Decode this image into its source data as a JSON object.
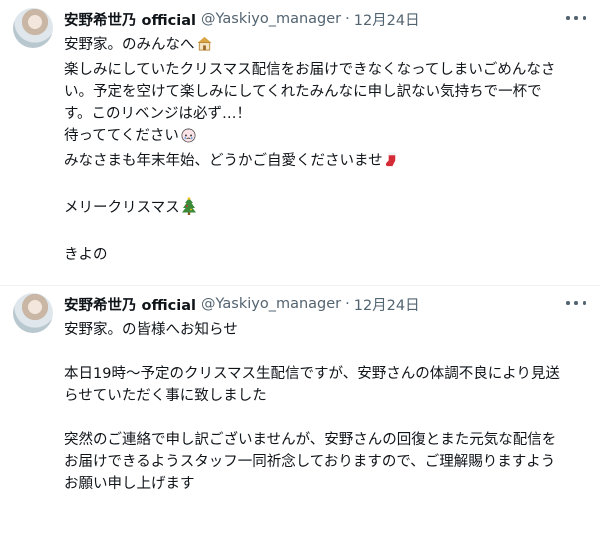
{
  "tweets": [
    {
      "author_name": "安野希世乃 official",
      "handle": "@Yaskiyo_manager",
      "separator": "·",
      "date": "12月24日",
      "body": [
        {
          "text": "安野家。のみんなへ",
          "emoji": "house-emoji"
        },
        {
          "text": "楽しみにしていたクリスマス配信をお届けできなくなってしまいごめんなさ"
        },
        {
          "text": "い。予定を空けて楽しみにしてくれたみんなに申し訳ない気持ちで一杯で"
        },
        {
          "text": "す。このリベンジは必ず…！"
        },
        {
          "text": "待っててください",
          "emoji": "crying-face-emoji"
        },
        {
          "text": "みなさまも年末年始、どうかご自愛くださいませ",
          "emoji": "stocking-emoji"
        },
        {
          "text": ""
        },
        {
          "text": "メリークリスマス",
          "emoji": "christmas-tree-emoji"
        },
        {
          "text": ""
        },
        {
          "text": "きよの"
        }
      ]
    },
    {
      "author_name": "安野希世乃 official",
      "handle": "@Yaskiyo_manager",
      "separator": "·",
      "date": "12月24日",
      "body": [
        {
          "text": "安野家。の皆様へお知らせ"
        },
        {
          "text": ""
        },
        {
          "text": "本日19時～予定のクリスマス生配信ですが、安野さんの体調不良により見送"
        },
        {
          "text": "らせていただく事に致しました"
        },
        {
          "text": ""
        },
        {
          "text": "突然のご連絡で申し訳ございませんが、安野さんの回復とまた元気な配信を"
        },
        {
          "text": "お届けできるようスタッフ一同祈念しておりますので、ご理解賜りますよう"
        },
        {
          "text": "お願い申し上げます"
        }
      ]
    }
  ],
  "icons": {
    "more": "more-horizontal-icon"
  },
  "colors": {
    "text": "#0f1419",
    "secondary": "#536471",
    "separator": "#eff3f4"
  }
}
